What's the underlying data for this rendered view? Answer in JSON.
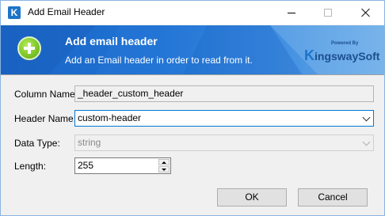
{
  "window": {
    "title": "Add Email Header",
    "app_icon_glyph": "K"
  },
  "banner": {
    "title": "Add email header",
    "subtitle": "Add an Email header in order to read from it.",
    "logo_small": "Powered By",
    "logo_k": "K",
    "logo_text": "ingswaySoft",
    "icon": "plus-circle-icon",
    "accent_color": "#1f73d4",
    "icon_color": "#7fc82a"
  },
  "form": {
    "column_name_label": "Column Name:",
    "column_name_value": "_header_custom_header",
    "header_name_label": "Header Name:",
    "header_name_value": "custom-header",
    "data_type_label": "Data Type:",
    "data_type_value": "string",
    "length_label": "Length:",
    "length_value": "255"
  },
  "buttons": {
    "ok": "OK",
    "cancel": "Cancel"
  }
}
